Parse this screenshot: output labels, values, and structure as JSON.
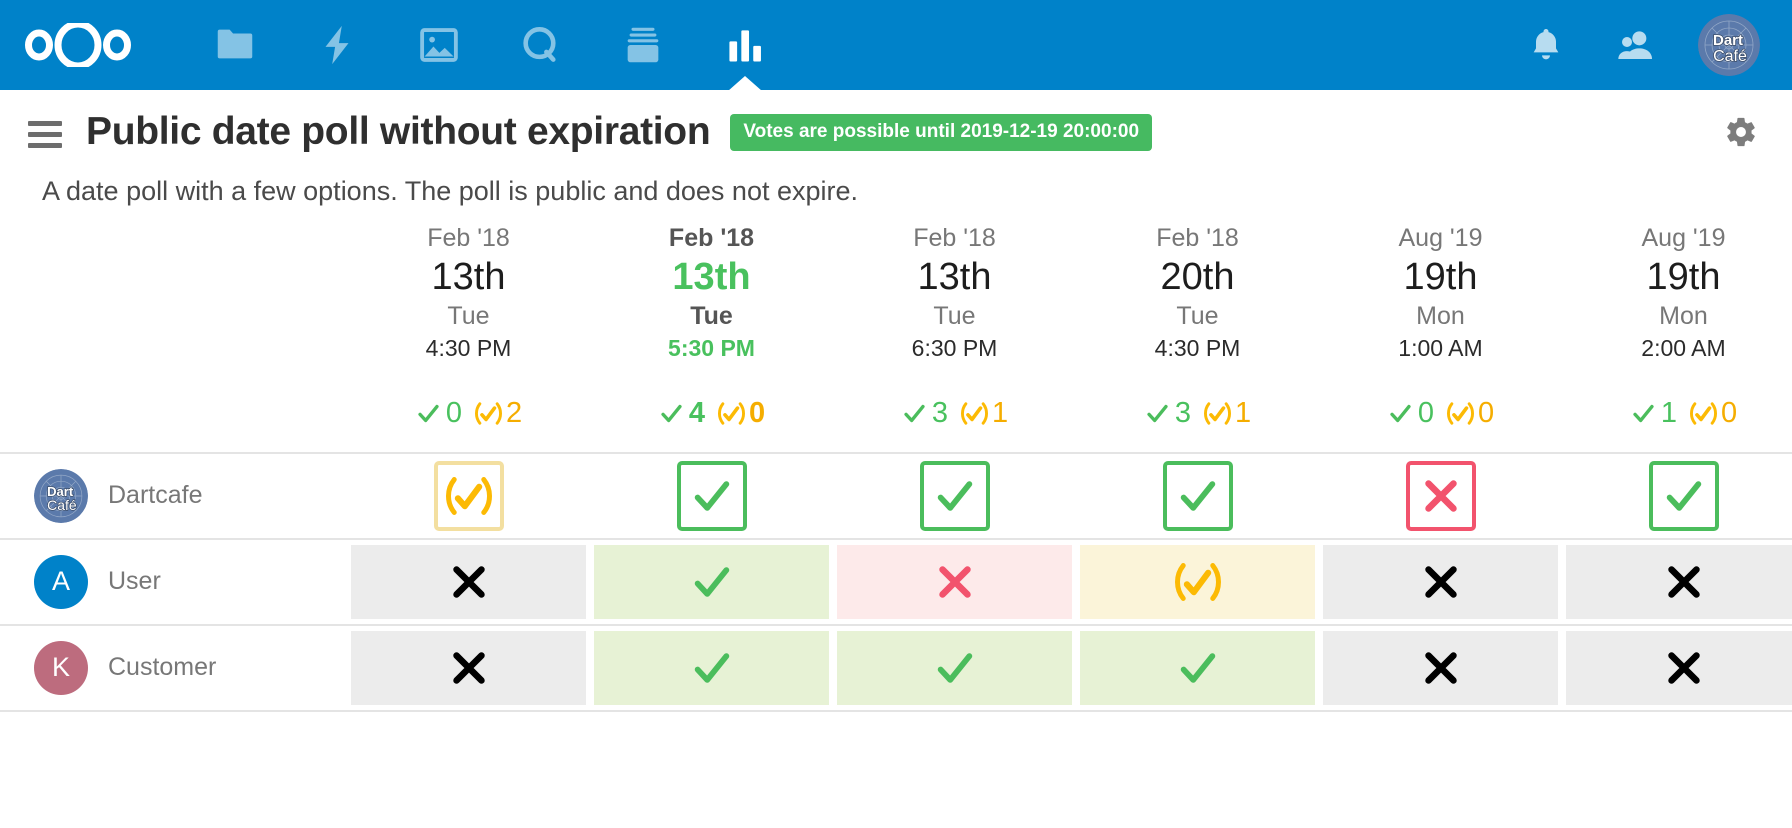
{
  "topbar": {
    "logo_name": "nextcloud-logo",
    "apps": [
      {
        "id": "files",
        "label": "Files",
        "icon": "folder-icon",
        "active": false
      },
      {
        "id": "activity",
        "label": "Activity",
        "icon": "lightning-icon",
        "active": false
      },
      {
        "id": "photos",
        "label": "Photos",
        "icon": "image-icon",
        "active": false
      },
      {
        "id": "search",
        "label": "Search",
        "icon": "magnifier-icon",
        "active": false
      },
      {
        "id": "archive",
        "label": "Archive",
        "icon": "archive-icon",
        "active": false
      },
      {
        "id": "polls",
        "label": "Polls",
        "icon": "bar-chart-icon",
        "active": true
      }
    ],
    "notifications_label": "Notifications",
    "contacts_label": "Contacts",
    "avatar_label": "Dart Café",
    "background_color": "#0082c9"
  },
  "header": {
    "menu_label": "Navigation",
    "title": "Public date poll without expiration",
    "badge": "Votes are possible until 2019-12-19 20:00:00",
    "badge_color": "#46ba61",
    "settings_label": "Settings"
  },
  "description": "A date poll with a few options. The poll is public and does not expire.",
  "poll": {
    "options": [
      {
        "month": "Feb '18",
        "day": "13th",
        "dow": "Tue",
        "time": "4:30 PM",
        "highlight": false,
        "yes": "0",
        "maybe": "2"
      },
      {
        "month": "Feb '18",
        "day": "13th",
        "dow": "Tue",
        "time": "5:30 PM",
        "highlight": true,
        "yes": "4",
        "maybe": "0"
      },
      {
        "month": "Feb '18",
        "day": "13th",
        "dow": "Tue",
        "time": "6:30 PM",
        "highlight": false,
        "yes": "3",
        "maybe": "1"
      },
      {
        "month": "Feb '18",
        "day": "20th",
        "dow": "Tue",
        "time": "4:30 PM",
        "highlight": false,
        "yes": "3",
        "maybe": "1"
      },
      {
        "month": "Aug '19",
        "day": "19th",
        "dow": "Mon",
        "time": "1:00 AM",
        "highlight": false,
        "yes": "0",
        "maybe": "0"
      },
      {
        "month": "Aug '19",
        "day": "19th",
        "dow": "Mon",
        "time": "2:00 AM",
        "highlight": false,
        "yes": "1",
        "maybe": "0"
      }
    ],
    "participants": [
      {
        "name": "Dartcafe",
        "avatar_type": "image",
        "avatar_initial": "D",
        "avatar_color": "#5b7aab",
        "own_row": true,
        "votes": [
          "maybe",
          "yes",
          "yes",
          "yes",
          "no",
          "yes"
        ]
      },
      {
        "name": "User",
        "avatar_type": "initial",
        "avatar_initial": "A",
        "avatar_color": "#0082c9",
        "own_row": false,
        "votes": [
          "unvoted",
          "yes",
          "no",
          "maybe",
          "unvoted",
          "unvoted"
        ]
      },
      {
        "name": "Customer",
        "avatar_type": "initial",
        "avatar_initial": "K",
        "avatar_color": "#bd6c7e",
        "own_row": false,
        "votes": [
          "unvoted",
          "yes",
          "yes",
          "yes",
          "unvoted",
          "unvoted"
        ]
      }
    ]
  },
  "colors": {
    "yes": "#4bbd5c",
    "no": "#f2536d",
    "maybe": "#fcba04",
    "unvoted": "#000000",
    "brand": "#0082c9"
  }
}
